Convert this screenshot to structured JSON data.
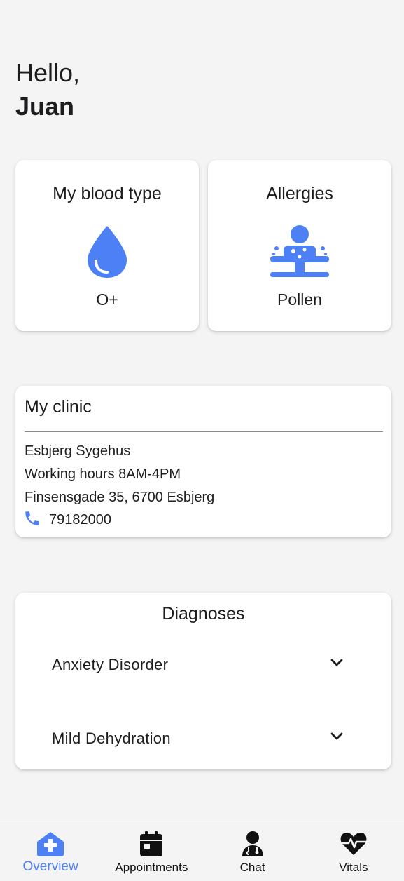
{
  "greeting": {
    "hello": "Hello,",
    "name": "Juan"
  },
  "blood_card": {
    "title": "My blood type",
    "value": "O+",
    "icon": "blood-drop-icon"
  },
  "allergy_card": {
    "title": "Allergies",
    "value": "Pollen",
    "icon": "allergy-person-icon"
  },
  "clinic": {
    "title": "My clinic",
    "name": "Esbjerg Sygehus",
    "hours": "Working hours 8AM-4PM",
    "address": "Finsensgade 35, 6700 Esbjerg",
    "phone": "79182000",
    "phone_icon": "phone-icon"
  },
  "diagnoses": {
    "title": "Diagnoses",
    "items": [
      {
        "label": "Anxiety Disorder"
      },
      {
        "label": "Mild Dehydration"
      }
    ]
  },
  "nav": {
    "items": [
      {
        "label": "Overview",
        "icon": "clinic-home-icon",
        "active": true
      },
      {
        "label": "Appointments",
        "icon": "calendar-icon",
        "active": false
      },
      {
        "label": "Chat",
        "icon": "doctor-icon",
        "active": false
      },
      {
        "label": "Vitals",
        "icon": "heartbeat-icon",
        "active": false
      }
    ]
  },
  "colors": {
    "accent": "#4d7ff5",
    "background": "#f4f4f4",
    "card": "#ffffff",
    "text": "#1d1d1f"
  }
}
